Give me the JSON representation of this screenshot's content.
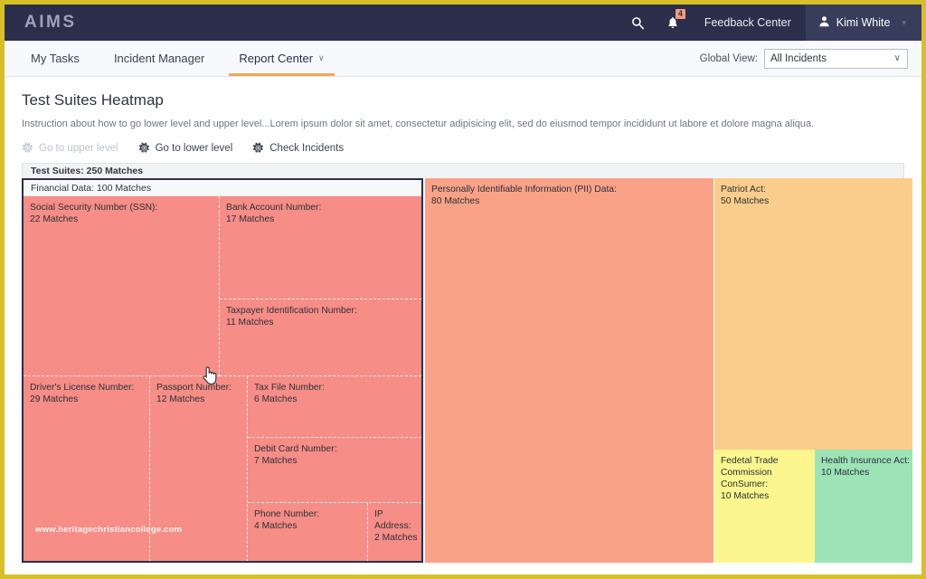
{
  "topbar": {
    "brand": "AIMS",
    "search_icon": "search-icon",
    "bell_icon": "bell-icon",
    "notification_count": "4",
    "feedback_center": "Feedback Center",
    "user_icon": "user-avatar-icon",
    "user_name": "Kimi White",
    "user_caret": "▾"
  },
  "nav": {
    "tabs": [
      {
        "label": "My Tasks",
        "active": false,
        "caret": ""
      },
      {
        "label": "Incident Manager",
        "active": false,
        "caret": ""
      },
      {
        "label": "Report Center",
        "active": true,
        "caret": "∨"
      }
    ],
    "global_view_label": "Global View:",
    "global_view_value": "All Incidents",
    "global_view_caret": "∨"
  },
  "page": {
    "title": "Test Suites Heatmap",
    "description": "Instruction about how to go lower level and upper level...Lorem ipsum dolor sit amet, consectetur adipisicing elit, sed do eiusmod tempor incididunt ut labore et dolore magna aliqua."
  },
  "toolbar": {
    "upper_level": "Go to upper level",
    "lower_level": "Go to lower level",
    "check_incidents": "Check Incidents"
  },
  "treemap_header": "Test Suites: 250 Matches",
  "watermark": "www.heritagechristiancollege.com",
  "colors": {
    "navy": "#2b2f4c",
    "accent_orange": "#f0a955",
    "page_border": "#d6c02a",
    "financial": "#f68d86",
    "pii": "#f9a287",
    "patriot": "#fbcd8c",
    "ftc": "#fbf78e",
    "hia": "#9ce3b6"
  },
  "chart_data": {
    "type": "treemap",
    "title": "Test Suites Heatmap",
    "root": {
      "label": "Test Suites",
      "value": 250,
      "value_label": "250 Matches"
    },
    "groups": [
      {
        "label": "Financial Data",
        "value": 100,
        "header": "Financial Data: 100 Matches",
        "color": "#f68d86",
        "children": [
          {
            "label": "Social Security Number (SSN):",
            "value": 22,
            "value_label": "22 Matches"
          },
          {
            "label": "Bank Account Number:",
            "value": 17,
            "value_label": "17 Matches"
          },
          {
            "label": "Taxpayer Identification Number:",
            "value": 11,
            "value_label": "11 Matches"
          },
          {
            "label": "Driver's License Number:",
            "value": 29,
            "value_label": "29 Matches"
          },
          {
            "label": "Passport Number:",
            "value": 12,
            "value_label": "12 Matches"
          },
          {
            "label": "Tax File Number:",
            "value": 6,
            "value_label": "6 Matches"
          },
          {
            "label": "Debit Card Number:",
            "value": 7,
            "value_label": "7 Matches"
          },
          {
            "label": "Phone Number:",
            "value": 4,
            "value_label": "4 Matches"
          },
          {
            "label": "IP Address:",
            "value": 2,
            "value_label": "2 Matches"
          }
        ]
      },
      {
        "label": "Personally Identifiable Information (PII) Data:",
        "value": 80,
        "value_label": "80 Matches",
        "color": "#f9a287",
        "children": []
      },
      {
        "label": "Patriot Act:",
        "value": 50,
        "value_label": "50 Matches",
        "color": "#fbcd8c",
        "children": []
      },
      {
        "label": "Fedetal Trade Commission ConSumer:",
        "value": 10,
        "value_label": "10 Matches",
        "color": "#fbf78e",
        "children": []
      },
      {
        "label": "Health Insurance Act:",
        "value": 10,
        "value_label": "10 Matches",
        "color": "#9ce3b6",
        "children": []
      }
    ]
  }
}
